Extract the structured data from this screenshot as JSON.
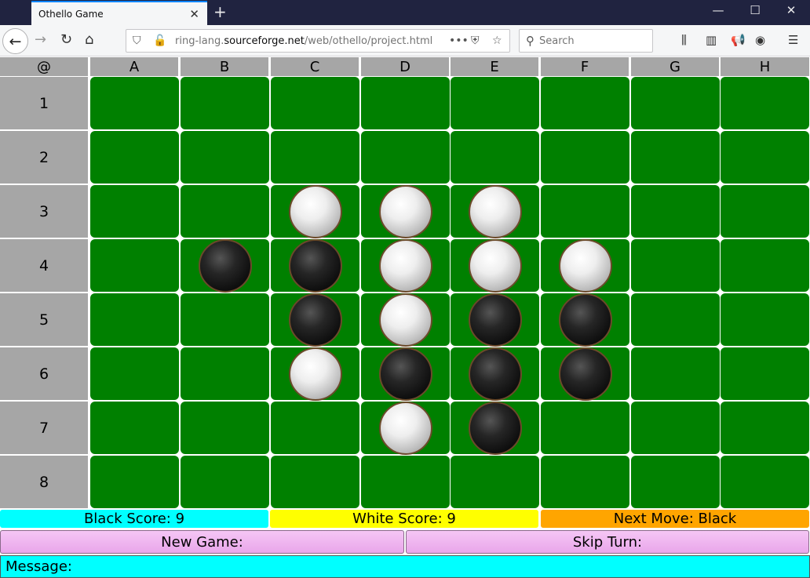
{
  "browser": {
    "tab_title": "Othello Game",
    "url_prefix": "ring-lang.",
    "url_domain": "sourceforge.net",
    "url_path": "/web/othello/project.html",
    "search_placeholder": "Search"
  },
  "board": {
    "corner": "@",
    "columns": [
      "A",
      "B",
      "C",
      "D",
      "E",
      "F",
      "G",
      "H"
    ],
    "rows": [
      "1",
      "2",
      "3",
      "4",
      "5",
      "6",
      "7",
      "8"
    ],
    "cells": [
      [
        "",
        "",
        "",
        "",
        "",
        "",
        "",
        ""
      ],
      [
        "",
        "",
        "",
        "",
        "",
        "",
        "",
        ""
      ],
      [
        "",
        "",
        "white",
        "white",
        "white",
        "",
        "",
        ""
      ],
      [
        "",
        "black",
        "black",
        "white",
        "white",
        "white",
        "",
        ""
      ],
      [
        "",
        "",
        "black",
        "white",
        "black",
        "black",
        "",
        ""
      ],
      [
        "",
        "",
        "white",
        "black",
        "black",
        "black",
        "",
        ""
      ],
      [
        "",
        "",
        "",
        "white",
        "black",
        "",
        "",
        ""
      ],
      [
        "",
        "",
        "",
        "",
        "",
        "",
        "",
        ""
      ]
    ]
  },
  "status": {
    "black_score": "Black Score: 9",
    "white_score": "White Score: 9",
    "next_move": "Next Move: Black"
  },
  "buttons": {
    "new_game": "New Game:",
    "skip_turn": "Skip Turn:"
  },
  "message": "Message:",
  "colors": {
    "board_green": "#008000",
    "header_gray": "#a6a6a6",
    "black_score_bg": "#00ffff",
    "white_score_bg": "#ffff00",
    "next_move_bg": "#ffa500",
    "button_bg": "#f0b4f0"
  }
}
